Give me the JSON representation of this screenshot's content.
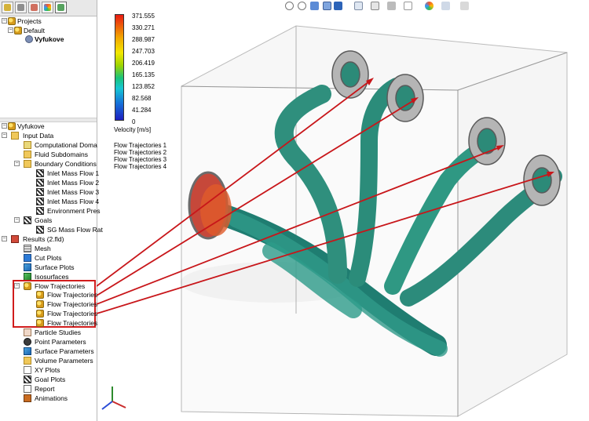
{
  "left_panel": {
    "projects_tree": {
      "projects": "Projects",
      "default": "Default",
      "config": "Vyfukove"
    },
    "analysis_tree": {
      "root": "Vyfukove",
      "input_data": "Input Data",
      "computational_domain": "Computational Doma",
      "fluid_subdomains": "Fluid Subdomains",
      "boundary_conditions": "Boundary Conditions",
      "inlet_mass_flows": [
        "Inlet Mass Flow 1",
        "Inlet Mass Flow 2",
        "Inlet Mass Flow 3",
        "Inlet Mass Flow 4"
      ],
      "environment_pressure": "Environment Pres",
      "goals": "Goals",
      "sg_mass_flow_rate": "SG Mass Flow Rat",
      "results": "Results (2.fld)",
      "mesh": "Mesh",
      "cut_plots": "Cut Plots",
      "surface_plots": "Surface Plots",
      "isosurfaces": "Isosurfaces",
      "flow_trajectories": "Flow Trajectories",
      "flow_trajectory_items": [
        "Flow Trajectories",
        "Flow Trajectories",
        "Flow Trajectories",
        "Flow Trajectories"
      ],
      "particle_studies": "Particle Studies",
      "point_parameters": "Point Parameters",
      "surface_parameters": "Surface Parameters",
      "volume_parameters": "Volume Parameters",
      "xy_plots": "XY Plots",
      "goal_plots": "Goal Plots",
      "report": "Report",
      "animations": "Animations"
    }
  },
  "viewport": {
    "legend": {
      "title": "Velocity [m/s]",
      "values": [
        "371.555",
        "330.271",
        "288.987",
        "247.703",
        "206.419",
        "165.135",
        "123.852",
        "82.568",
        "41.284",
        "0"
      ],
      "colors": [
        "#e81a12",
        "#f05a0a",
        "#f2a900",
        "#f3e700",
        "#9ed400",
        "#19c37a",
        "#16c6d3",
        "#1572d9",
        "#1b3dd0",
        "#1d1fbf"
      ]
    },
    "trajectory_series": [
      "Flow Trajectories 1",
      "Flow Trajectories 2",
      "Flow Trajectories 3",
      "Flow Trajectories 4"
    ],
    "callout_color": "#c8161a"
  }
}
